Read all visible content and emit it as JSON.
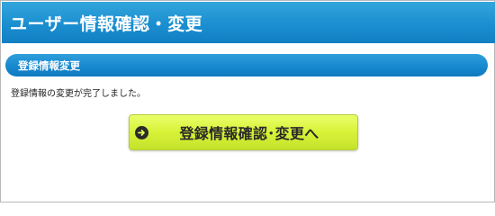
{
  "header": {
    "title": "ユーザー情報確認・変更"
  },
  "section": {
    "title": "登録情報変更"
  },
  "message": {
    "text": "登録情報の変更が完了しました。"
  },
  "action": {
    "label": "登録情報確認･変更へ",
    "icon": "arrow-right-circle-icon"
  },
  "colors": {
    "header_blue": "#1a8fd0",
    "button_lime": "#d7f237"
  }
}
